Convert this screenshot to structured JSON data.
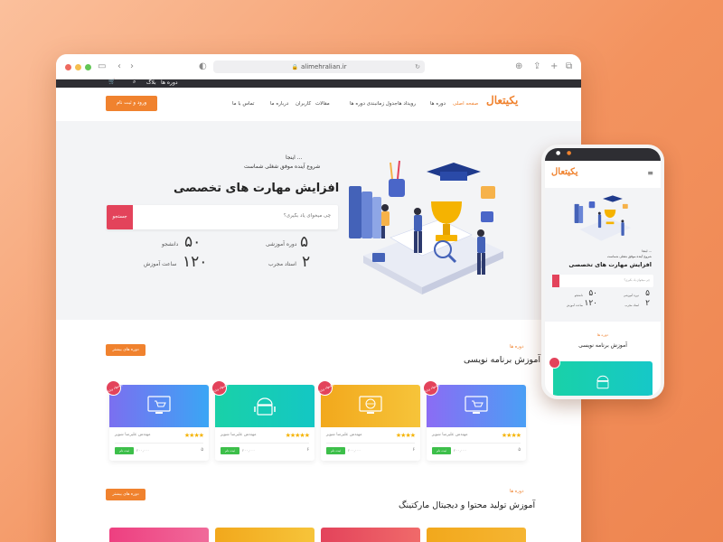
{
  "browser": {
    "url": "alimehralian.ir"
  },
  "site": {
    "topbar": {
      "courses": "دوره ها",
      "blog": "بلاگ"
    },
    "logo": "یکیتعال",
    "login_button": "ورود و ثبت نام",
    "menu": [
      {
        "label": "صفحه اصلی",
        "active": true
      },
      {
        "label": "دوره ها",
        "active": false
      },
      {
        "label": "رویداد ها",
        "active": false
      },
      {
        "label": "جدول زمانبندی دوره ها",
        "active": false
      },
      {
        "label": "مقالات",
        "active": false
      },
      {
        "label": "کاربران",
        "active": false
      },
      {
        "label": "درباره ما",
        "active": false
      },
      {
        "label": "تماس با ما",
        "active": false
      }
    ],
    "hero": {
      "line1": "اینجا ...",
      "line2": "شروع آینده موفق شغلی شماست",
      "title": "افزایش مهارت های تخصصی",
      "search_placeholder": "چی میخوای یاد بگیری؟",
      "search_button": "جستجو",
      "stats": [
        {
          "number": "۵",
          "label": "دوره آموزشی"
        },
        {
          "number": "۵۰",
          "label": "دانشجو"
        },
        {
          "number": "۲",
          "label": "استاد مجرب"
        },
        {
          "number": "۱۲۰",
          "label": "ساعت آموزش"
        }
      ]
    },
    "section1": {
      "tag": "دوره ها",
      "title": "آموزش برنامه نویسی",
      "more": "دوره های بیشتر",
      "cards": [
        {
          "badge": "پیشنهاد ویژه",
          "teacher": "مهندس علیرضا شوپز",
          "price": "۲۰۰,۰۰۰",
          "buy": "ثبت نام",
          "students": "۵",
          "icon": "cart-icon",
          "stars": "★★★★",
          "color_a": "#7b6ff0",
          "color_b": "#3aa6f5"
        },
        {
          "badge": "پیشنهاد ویژه",
          "teacher": "مهندس علیرضا شوپز",
          "price": "۲۰۰,۰۰۰",
          "buy": "ثبت نام",
          "students": "۶",
          "icon": "globe-icon",
          "stars": "★★★★",
          "color_a": "#f2a81c",
          "color_b": "#f6c43a"
        },
        {
          "badge": "پیشنهاد ویژه",
          "teacher": "مهندس علیرضا شوپز",
          "price": "۲۰۰,۰۰۰",
          "buy": "ثبت نام",
          "students": "۶",
          "icon": "android-icon",
          "stars": "★★★★★",
          "color_a": "#19d1a8",
          "color_b": "#14c7c4"
        },
        {
          "badge": "پیشنهاد ویژه",
          "teacher": "مهندس علیرضا شوپز",
          "price": "۲۰۰,۰۰۰",
          "buy": "ثبت نام",
          "students": "۵",
          "icon": "cart-icon",
          "stars": "★★★★",
          "color_a": "#8b6cf4",
          "color_b": "#4a9ff5"
        }
      ]
    },
    "section2": {
      "tag": "دوره ها",
      "title": "آموزش تولید محتوا و دیجیتال مارکتینگ",
      "more": "دوره های بیشتر"
    }
  },
  "phone": {
    "logo": "یکیتعال",
    "line1": "اینجا ...",
    "line2": "شروع آینده موفق شغلی شماست",
    "title": "افزایش مهارت های تخصصی",
    "search_placeholder": "چی میخوای یاد بگیری؟",
    "stats": [
      {
        "number": "۵",
        "label": "دوره آموزشی"
      },
      {
        "number": "۵۰",
        "label": "دانشجو"
      },
      {
        "number": "۲",
        "label": "استاد مجرب"
      },
      {
        "number": "۱۲۰",
        "label": "ساعت آموزش"
      }
    ],
    "section_tag": "دوره ها",
    "section_title": "آموزش برنامه نویسی"
  }
}
